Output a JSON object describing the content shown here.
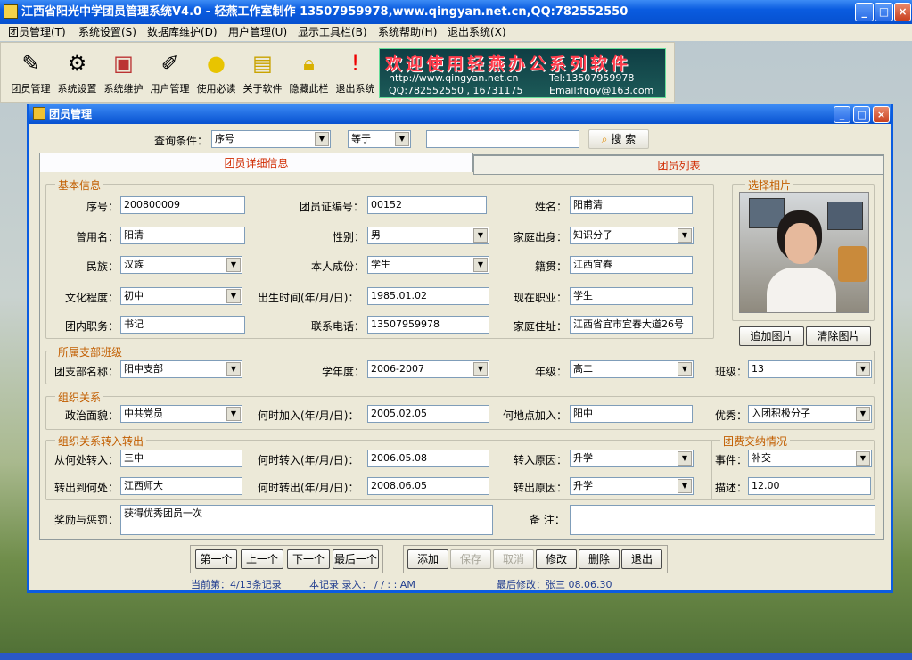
{
  "titlebar": {
    "title": "江西省阳光中学团员管理系统V4.0 - 轻燕工作室制作 13507959978,www.qingyan.net.cn,QQ:782552550"
  },
  "menu": {
    "items": [
      "团员管理(T)",
      "系统设置(S)",
      "数据库维护(D)",
      "用户管理(U)",
      "显示工具栏(B)",
      "系统帮助(H)",
      "退出系统(X)"
    ]
  },
  "toolbar": {
    "buttons": [
      "团员管理",
      "系统设置",
      "系统维护",
      "用户管理",
      "使用必读",
      "关于软件",
      "隐藏此栏",
      "退出系统"
    ],
    "icons": [
      "member-icon",
      "settings-icon",
      "maintenance-icon",
      "user-icon",
      "bulb-icon",
      "book-icon",
      "lock-icon",
      "exit-icon"
    ]
  },
  "banner": {
    "slogan": "欢迎使用轻燕办公系列软件",
    "url": "http://www.qingyan.net.cn",
    "tel": "Tel:13507959978",
    "qq": "QQ:782552550 , 16731175",
    "email": "Email:fqoy@163.com"
  },
  "window": {
    "title": "团员管理"
  },
  "query": {
    "label": "查询条件：",
    "field": "序号",
    "operator": "等于",
    "value": "",
    "search_label": "搜 索"
  },
  "tabs": {
    "detail": "团员详细信息",
    "list": "团员列表"
  },
  "basic": {
    "title": "基本信息",
    "seq_label": "序号：",
    "seq": "200800009",
    "card_label": "团员证编号：",
    "card": "00152",
    "name_label": "姓名：",
    "name": "阳甫清",
    "alias_label": "曾用名：",
    "alias": "阳清",
    "sex_label": "性别：",
    "sex": "男",
    "family_label": "家庭出身：",
    "family": "知识分子",
    "nation_label": "民族：",
    "nation": "汉族",
    "status_label": "本人成份：",
    "status": "学生",
    "native_label": "籍贯：",
    "native": "江西宜春",
    "edu_label": "文化程度：",
    "edu": "初中",
    "birth_label": "出生时间(年/月/日)：",
    "birth": "1985.01.02",
    "job_label": "现在职业：",
    "job": "学生",
    "post_label": "团内职务：",
    "post": "书记",
    "phone_label": "联系电话：",
    "phone": "13507959978",
    "addr_label": "家庭住址：",
    "addr": "江西省宜市宜春大道26号"
  },
  "photo": {
    "title": "选择相片",
    "add": "追加图片",
    "clear": "清除图片"
  },
  "branch": {
    "title": "所属支部班级",
    "branch_label": "团支部名称：",
    "branch": "阳中支部",
    "year_label": "学年度：",
    "year": "2006-2007",
    "grade_label": "年级：",
    "grade": "高二",
    "class_label": "班级：",
    "class": "13"
  },
  "org": {
    "title": "组织关系",
    "politics_label": "政治面貌：",
    "politics": "中共党员",
    "join_time_label": "何时加入(年/月/日)：",
    "join_time": "2005.02.05",
    "join_place_label": "何地点加入：",
    "join_place": "阳中",
    "excellent_label": "优秀：",
    "excellent": "入团积极分子"
  },
  "transfer": {
    "title": "组织关系转入转出",
    "from_label": "从何处转入：",
    "from": "三中",
    "in_time_label": "何时转入(年/月/日)：",
    "in_time": "2006.05.08",
    "in_reason_label": "转入原因：",
    "in_reason": "升学",
    "to_label": "转出到何处：",
    "to": "江西师大",
    "out_time_label": "何时转出(年/月/日)：",
    "out_time": "2008.06.05",
    "out_reason_label": "转出原因：",
    "out_reason": "升学"
  },
  "fee": {
    "title": "团费交纳情况",
    "event_label": "事件：",
    "event": "补交",
    "desc_label": "描述：",
    "desc": "12.00"
  },
  "reward_label": "奖励与惩罚：",
  "reward": "获得优秀团员一次",
  "remark_label": "备 注：",
  "remark": "",
  "nav": {
    "first": "第一个",
    "prev": "上一个",
    "next": "下一个",
    "last": "最后一个"
  },
  "actions": {
    "add": "添加",
    "save": "保存",
    "cancel": "取消",
    "edit": "修改",
    "delete": "删除",
    "exit": "退出"
  },
  "status": {
    "current": "当前第：4/13条记录",
    "entered": "本记录 录入：  /  /    :  :  AM",
    "modified": "最后修改：张三  08.06.30"
  }
}
